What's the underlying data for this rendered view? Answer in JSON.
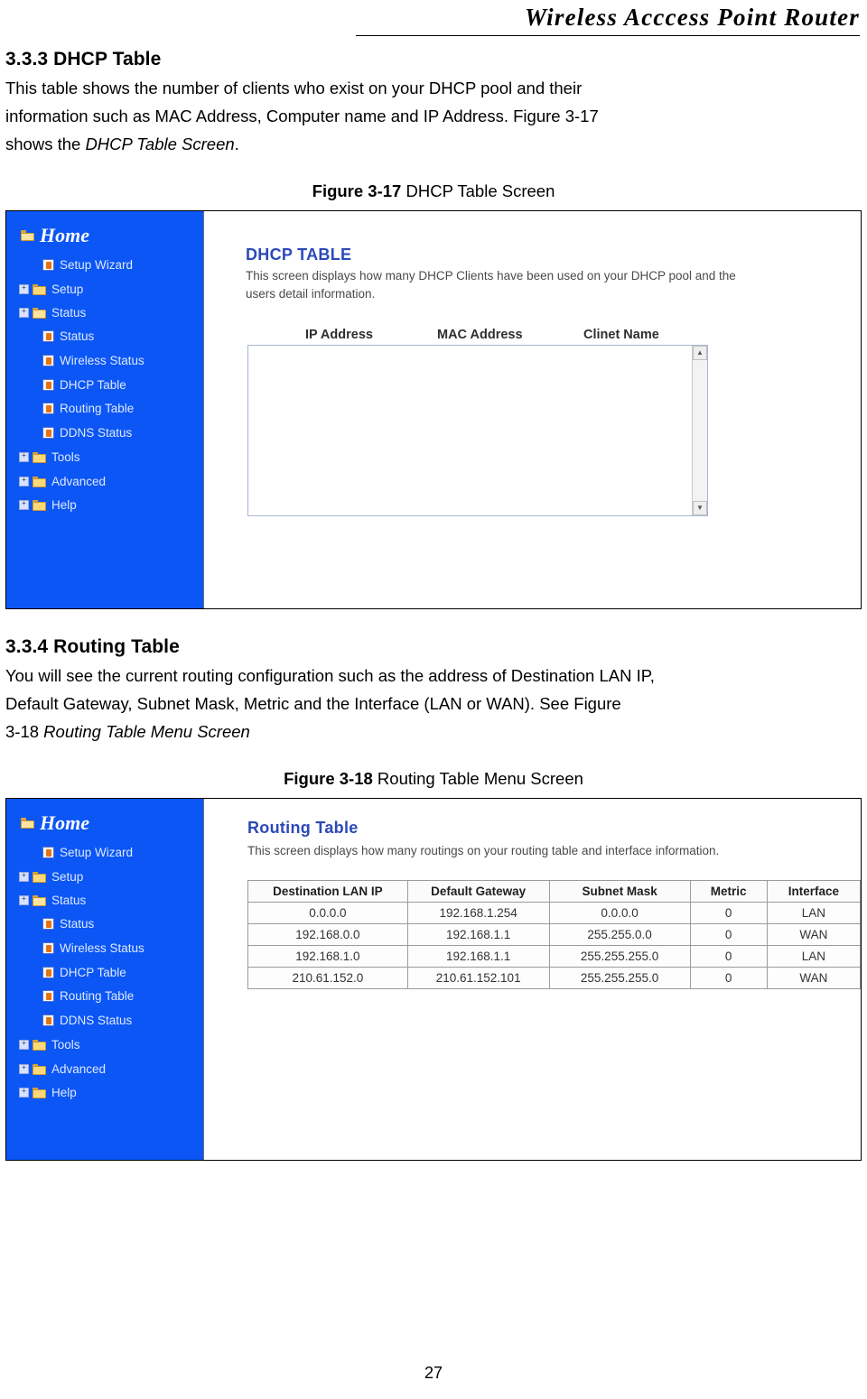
{
  "header": {
    "title": "Wireless  Acccess  Point  Router"
  },
  "sections": [
    {
      "heading": "3.3.3 DHCP Table",
      "paragraph_1": "This table shows the number of clients who exist on your DHCP pool and their",
      "paragraph_2": "information such as MAC Address, Computer name and IP Address. Figure 3-17",
      "paragraph_3_prefix": "shows the ",
      "paragraph_3_italic": "DHCP Table Screen",
      "paragraph_3_suffix": ".",
      "figure_label": "Figure 3-17",
      "figure_title": "DHCP Table Screen"
    },
    {
      "heading": "3.3.4 Routing Table",
      "paragraph_1": "You will see the current routing configuration such as the address of Destination LAN IP,",
      "paragraph_2": "Default Gateway, Subnet Mask, Metric and the Interface (LAN or WAN). See Figure",
      "paragraph_3_prefix": "3-18 ",
      "paragraph_3_italic": "Routing Table Menu Screen",
      "paragraph_3_suffix": "",
      "figure_label": "Figure 3-18",
      "figure_title": "Routing Table Menu Screen"
    }
  ],
  "nav": {
    "home_label": "Home",
    "items": [
      {
        "label": "Setup Wizard",
        "level": 2,
        "icon": "page-icon",
        "expander": false
      },
      {
        "label": "Setup",
        "level": 1,
        "icon": "folder-icon",
        "expander": true
      },
      {
        "label": "Status",
        "level": 1,
        "icon": "folder-open-icon",
        "expander": true
      },
      {
        "label": "Status",
        "level": 2,
        "icon": "page-icon",
        "expander": false
      },
      {
        "label": "Wireless Status",
        "level": 2,
        "icon": "page-icon",
        "expander": false
      },
      {
        "label": "DHCP Table",
        "level": 2,
        "icon": "page-icon",
        "expander": false
      },
      {
        "label": "Routing Table",
        "level": 2,
        "icon": "page-icon",
        "expander": false
      },
      {
        "label": "DDNS Status",
        "level": 2,
        "icon": "page-icon",
        "expander": false
      },
      {
        "label": "Tools",
        "level": 1,
        "icon": "folder-icon",
        "expander": true
      },
      {
        "label": "Advanced",
        "level": 1,
        "icon": "folder-icon",
        "expander": true
      },
      {
        "label": "Help",
        "level": 1,
        "icon": "folder-icon",
        "expander": true
      }
    ]
  },
  "dhcp_screen": {
    "title": "DHCP TABLE",
    "description_line1": "This screen displays how many DHCP Clients have been used on your DHCP pool and the",
    "description_line2": "users detail information.",
    "columns": [
      "IP Address",
      "MAC Address",
      "Clinet Name"
    ],
    "rows": [],
    "scroll_up": "▲",
    "scroll_down": "▼"
  },
  "routing_screen": {
    "title": "Routing Table",
    "description": "This screen displays how many routings on your routing table and interface information.",
    "columns": [
      "Destination LAN IP",
      "Default Gateway",
      "Subnet Mask",
      "Metric",
      "Interface"
    ],
    "rows": [
      [
        "0.0.0.0",
        "192.168.1.254",
        "0.0.0.0",
        "0",
        "LAN"
      ],
      [
        "192.168.0.0",
        "192.168.1.1",
        "255.255.0.0",
        "0",
        "WAN"
      ],
      [
        "192.168.1.0",
        "192.168.1.1",
        "255.255.255.0",
        "0",
        "LAN"
      ],
      [
        "210.61.152.0",
        "210.61.152.101",
        "255.255.255.0",
        "0",
        "WAN"
      ]
    ]
  },
  "page_number": "27",
  "colors": {
    "nav_background": "#0b56f5",
    "title_blue": "#2b49b8"
  }
}
